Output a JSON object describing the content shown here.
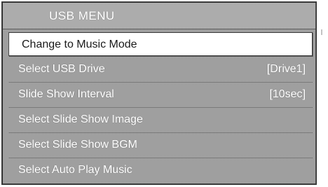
{
  "menu": {
    "title": "USB MENU",
    "items": [
      {
        "label": "Change to Music Mode",
        "value": "",
        "selected": true
      },
      {
        "label": "Select USB Drive",
        "value": "[Drive1]",
        "selected": false
      },
      {
        "label": "Slide Show Interval",
        "value": "[10sec]",
        "selected": false
      },
      {
        "label": "Select Slide Show Image",
        "value": "",
        "selected": false
      },
      {
        "label": "Select Slide Show BGM",
        "value": "",
        "selected": false
      },
      {
        "label": "Select Auto Play Music",
        "value": "",
        "selected": false
      }
    ]
  },
  "colors": {
    "text": "#ffffff",
    "selected_background": "#ffffff",
    "selected_text": "#1a1a1a",
    "panel_background": "#9c9c9c",
    "border": "#3a3a3a"
  }
}
